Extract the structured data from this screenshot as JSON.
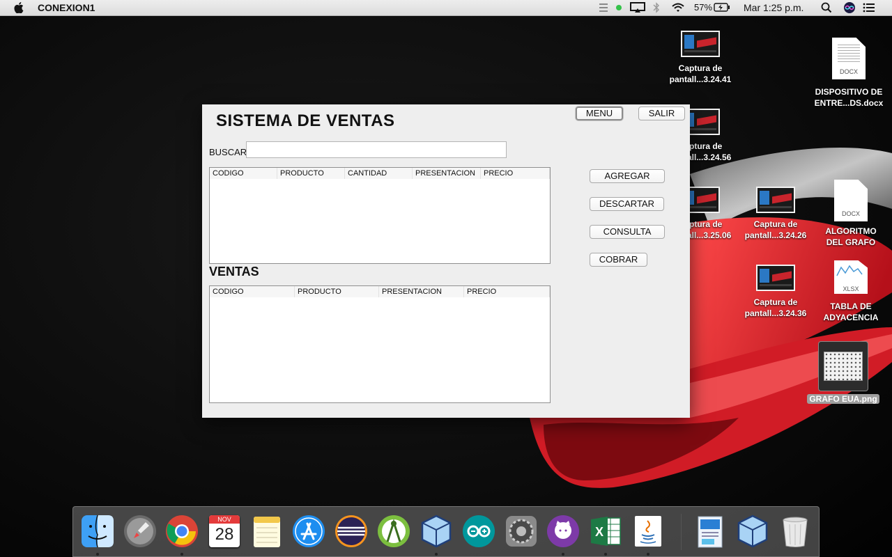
{
  "menubar": {
    "app_name": "CONEXION1",
    "battery": "57%",
    "clock": "Mar 1:25 p.m."
  },
  "desktop": {
    "icons": [
      {
        "name": "Captura de",
        "name2": "pantall...3.24.41"
      },
      {
        "name": "Captura de",
        "name2": "pantall...3.24.56"
      },
      {
        "name": "Captura de",
        "name2": "pantall...3.25.06"
      },
      {
        "name": "Captura de",
        "name2": "pantall...3.24.26"
      },
      {
        "name": "Captura de",
        "name2": "pantall...3.24.36"
      },
      {
        "name": "DISPOSITIVO DE",
        "name2": "ENTRE...DS.docx",
        "kind": "DOCX"
      },
      {
        "name": "ALGORITMO",
        "name2": "DEL GRAFO",
        "kind": "DOCX"
      },
      {
        "name": "TABLA DE",
        "name2": "ADYACENCIA",
        "kind": "XLSX"
      },
      {
        "name": "GRAFO EUA.png"
      }
    ]
  },
  "window": {
    "title": "SISTEMA DE VENTAS",
    "menu_label": "MENU",
    "exit_label": "SALIR",
    "search_label": "BUSCAR:",
    "search_value": "",
    "cart_table": {
      "columns": [
        "CODIGO",
        "PRODUCTO",
        "CANTIDAD",
        "PRESENTACION",
        "PRECIO"
      ]
    },
    "actions": {
      "add": "AGREGAR",
      "discard": "DESCARTAR",
      "query": "CONSULTA",
      "charge": "COBRAR"
    },
    "sales_heading": "VENTAS",
    "sales_table": {
      "columns": [
        "CODIGO",
        "PRODUCTO",
        "PRESENTACION",
        "PRECIO"
      ]
    }
  },
  "dock": {
    "calendar_month": "NOV",
    "calendar_day": "28",
    "apps": [
      "finder-icon",
      "launchpad-icon",
      "chrome-icon",
      "calendar-icon",
      "notes-icon",
      "app-store-icon",
      "eclipse-icon",
      "android-studio-icon",
      "virtualbox-icon",
      "arduino-icon",
      "system-preferences-icon",
      "github-icon",
      "excel-icon",
      "java-icon",
      "document-icon",
      "virtualbox-icon",
      "trash-icon"
    ]
  }
}
